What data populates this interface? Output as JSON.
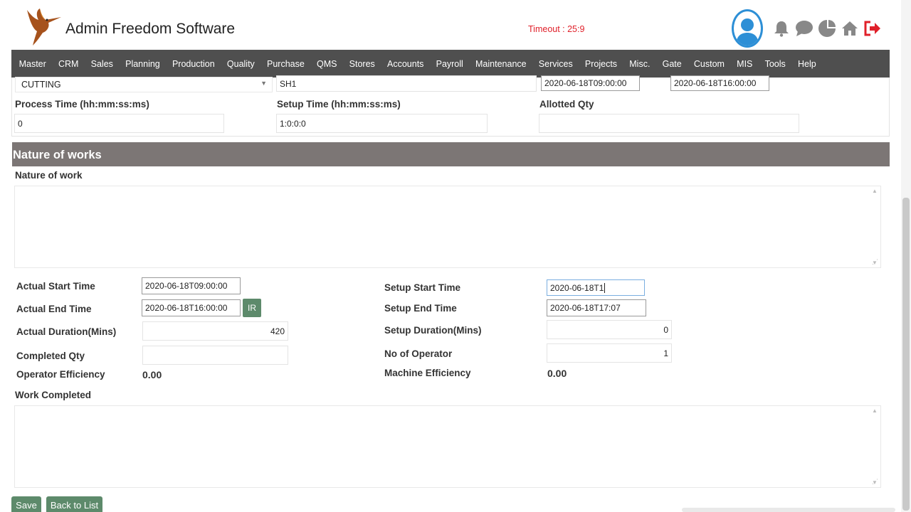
{
  "header": {
    "app_title": "Admin Freedom Software",
    "timeout": "Timeout : 25:9"
  },
  "nav": [
    "Master",
    "CRM",
    "Sales",
    "Planning",
    "Production",
    "Quality",
    "Purchase",
    "QMS",
    "Stores",
    "Accounts",
    "Payroll",
    "Maintenance",
    "Services",
    "Projects",
    "Misc.",
    "Gate",
    "Custom",
    "MIS",
    "Tools",
    "Help"
  ],
  "top_fields": {
    "process_select": "CUTTING",
    "shift": "SH1",
    "start_time": "2020-06-18T09:00:00",
    "end_time": "2020-06-18T16:00:00",
    "process_time_label": "Process Time (hh:mm:ss:ms)",
    "process_time_value": "0",
    "setup_time_label": "Setup Time (hh:mm:ss:ms)",
    "setup_time_value": "1:0:0:0",
    "allotted_qty_label": "Allotted Qty",
    "allotted_qty_value": ""
  },
  "nature": {
    "section_title": "Nature of works",
    "field_label": "Nature of work"
  },
  "actual": {
    "start_label": "Actual Start Time",
    "start_value": "2020-06-18T09:00:00",
    "end_label": "Actual End Time",
    "end_value": "2020-06-18T16:00:00",
    "ir_label": "IR",
    "duration_label": "Actual Duration(Mins)",
    "duration_value": "420",
    "completed_label": "Completed Qty",
    "completed_value": "",
    "op_eff_label": "Operator Efficiency",
    "op_eff_value": "0.00"
  },
  "setup": {
    "start_label": "Setup Start Time",
    "start_value": "2020-06-18T1",
    "end_label": "Setup End Time",
    "end_value": "2020-06-18T17:07",
    "duration_label": "Setup Duration(Mins)",
    "duration_value": "0",
    "operators_label": "No of Operator",
    "operators_value": "1",
    "mach_eff_label": "Machine Efficiency",
    "mach_eff_value": "0.00"
  },
  "work_completed_label": "Work Completed",
  "buttons": {
    "save": "Save",
    "back": "Back to List"
  },
  "colors": {
    "nav_bg": "#4f4f4f",
    "section_bg": "#7c7675",
    "button_bg": "#5d8a6b",
    "timeout": "#e0202a",
    "accent_blue": "#2d8fd6",
    "logout_red": "#e0202a"
  }
}
